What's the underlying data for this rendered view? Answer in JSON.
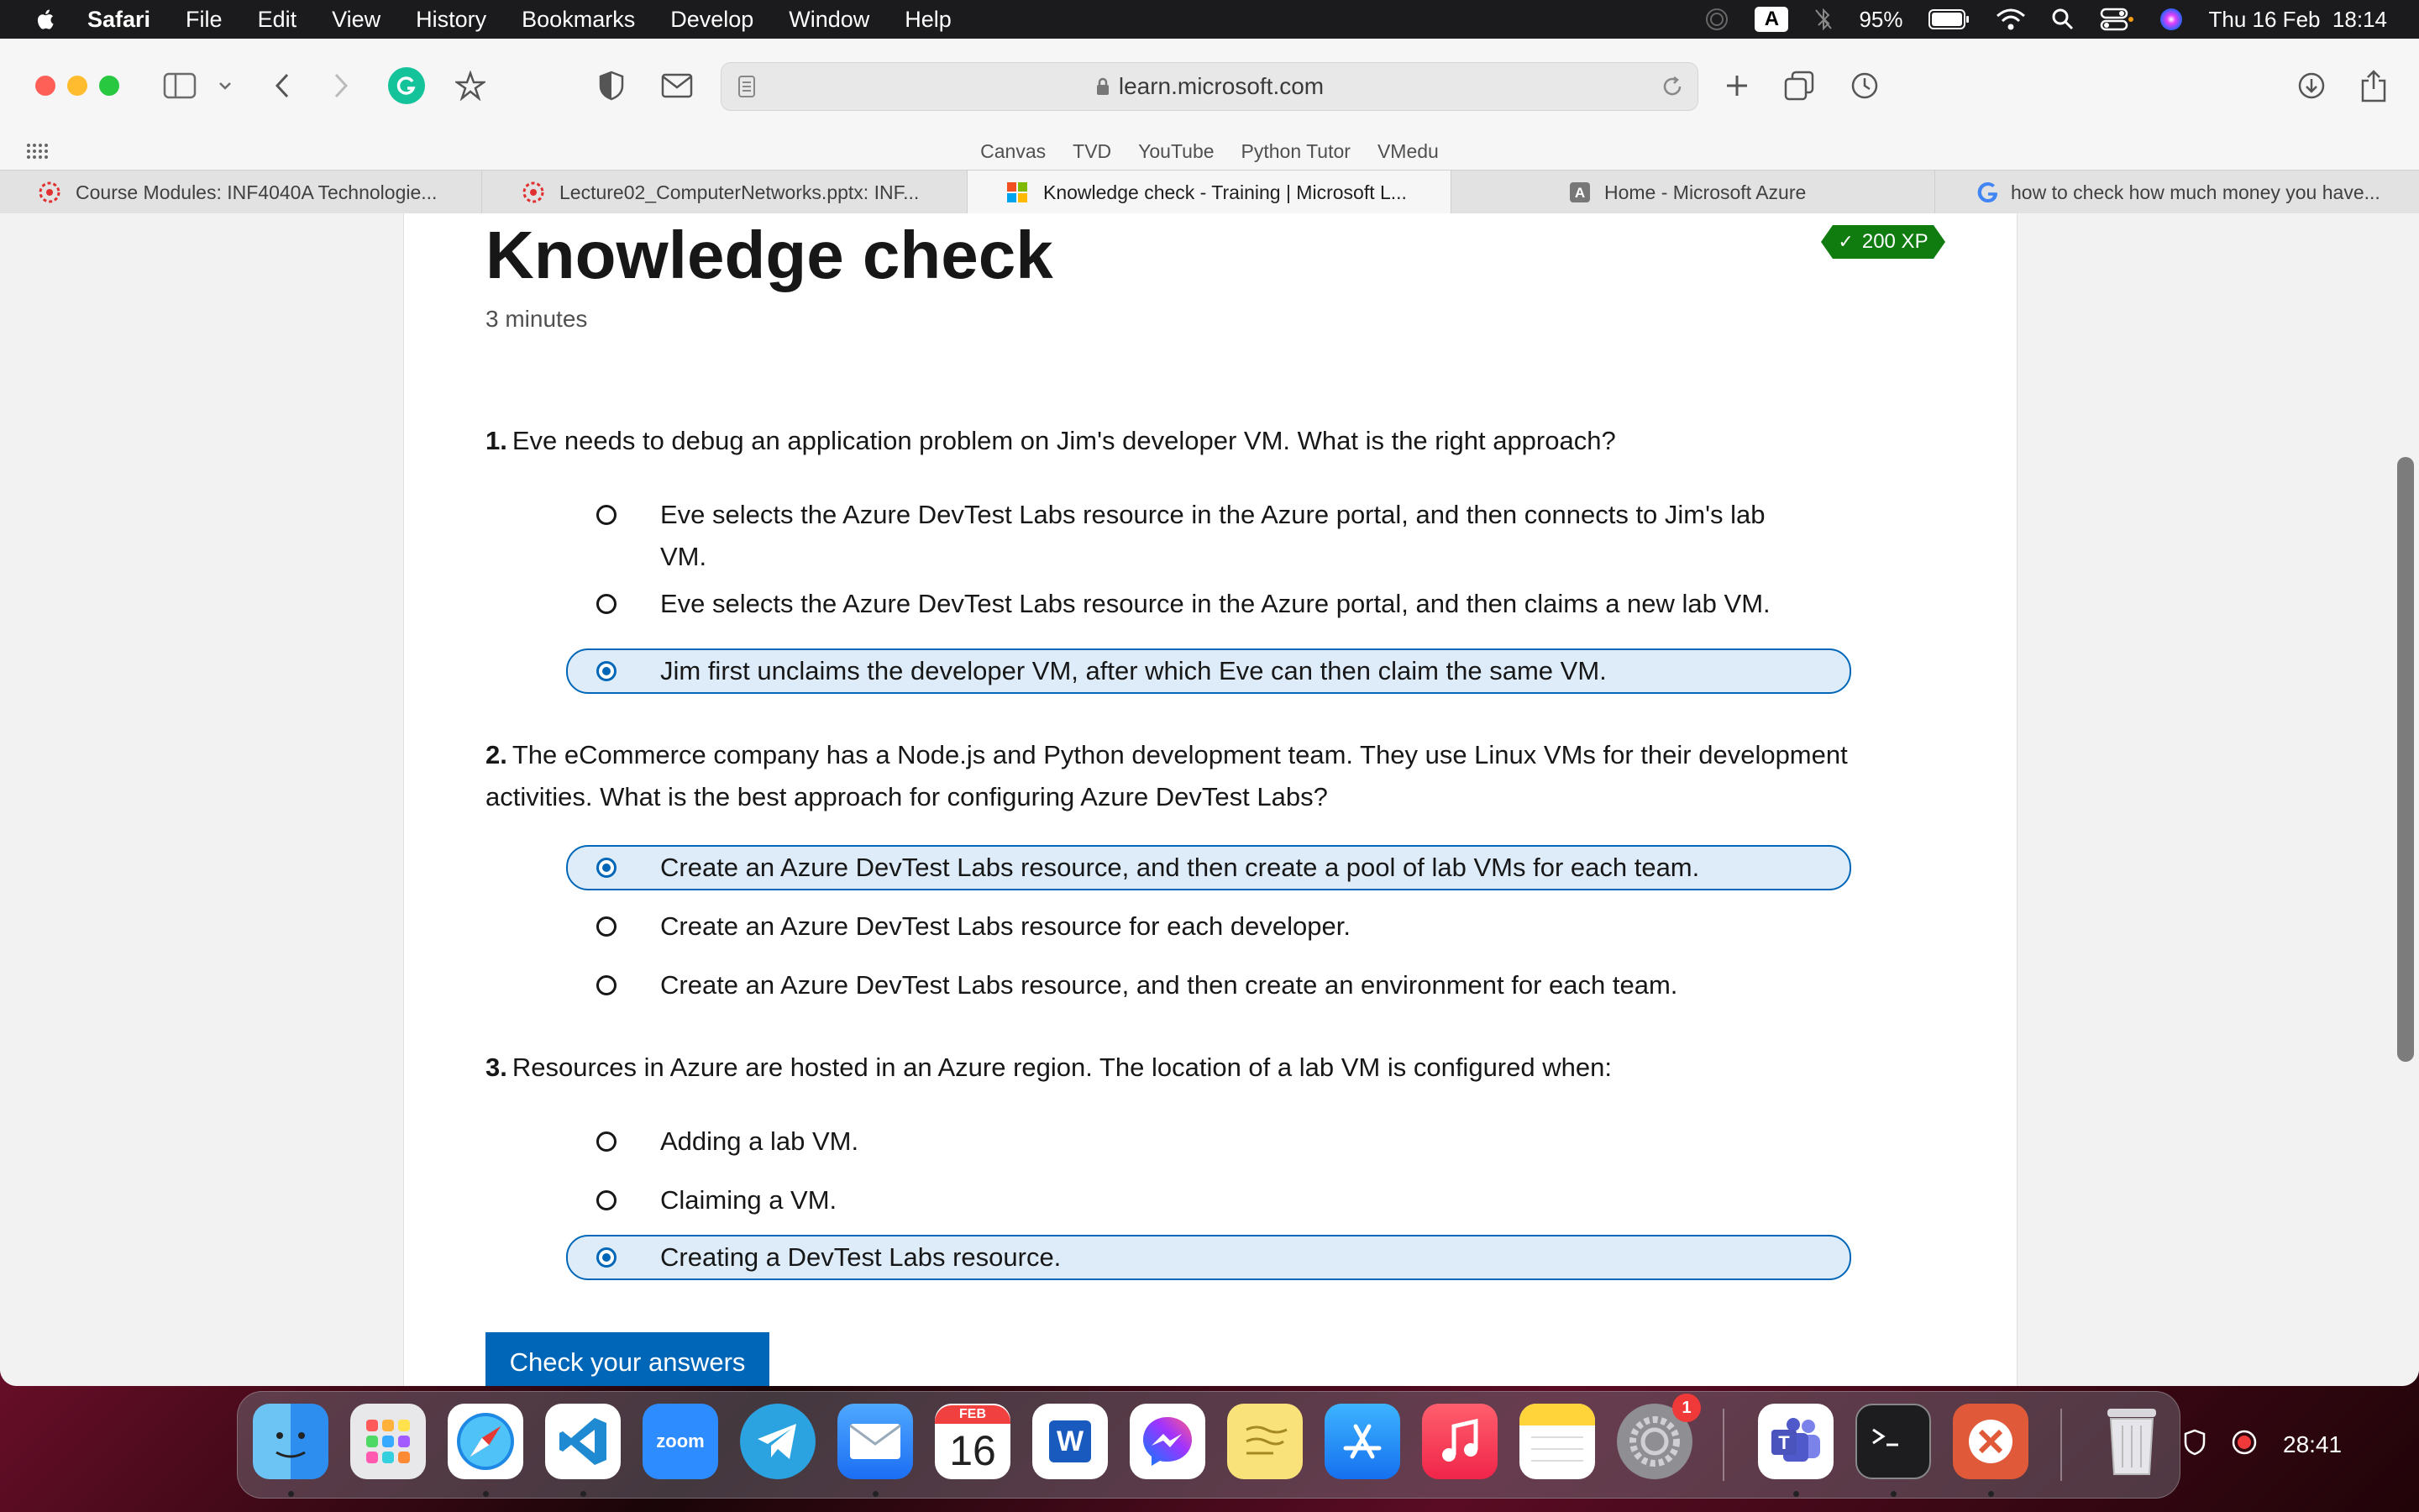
{
  "menubar": {
    "app": "Safari",
    "items": [
      "File",
      "Edit",
      "View",
      "History",
      "Bookmarks",
      "Develop",
      "Window",
      "Help"
    ],
    "keyboard_letter": "A",
    "battery": "95%",
    "datetime": "Thu 16 Feb  18:14"
  },
  "browser": {
    "address": "learn.microsoft.com",
    "bookmarks": [
      "Canvas",
      "TVD",
      "YouTube",
      "Python Tutor",
      "VMedu"
    ],
    "tabs": [
      {
        "title": "Course Modules: INF4040A Technologie..."
      },
      {
        "title": "Lecture02_ComputerNetworks.pptx: INF..."
      },
      {
        "title": "Knowledge check - Training | Microsoft L..."
      },
      {
        "title": "Home - Microsoft Azure"
      },
      {
        "title": "how to check how much money you have..."
      }
    ],
    "active_tab_index": 2
  },
  "page": {
    "title": "Knowledge check",
    "duration": "3 minutes",
    "xp": "200 XP",
    "questions": [
      {
        "number": "1.",
        "text": "Eve needs to debug an application problem on Jim's developer VM. What is the right approach?",
        "options": [
          "Eve selects the Azure DevTest Labs resource in the Azure portal, and then connects to Jim's lab VM.",
          "Eve selects the Azure DevTest Labs resource in the Azure portal, and then claims a new lab VM.",
          "Jim first unclaims the developer VM, after which Eve can then claim the same VM."
        ],
        "selected": 2
      },
      {
        "number": "2.",
        "text": "The eCommerce company has a Node.js and Python development team. They use Linux VMs for their development activities. What is the best approach for configuring Azure DevTest Labs?",
        "options": [
          "Create an Azure DevTest Labs resource, and then create a pool of lab VMs for each team.",
          "Create an Azure DevTest Labs resource for each developer.",
          "Create an Azure DevTest Labs resource, and then create an environment for each team."
        ],
        "selected": 0
      },
      {
        "number": "3.",
        "text": "Resources in Azure are hosted in an Azure region. The location of a lab VM is configured when:",
        "options": [
          "Adding a lab VM.",
          "Claiming a VM.",
          "Creating a DevTest Labs resource."
        ],
        "selected": 2
      }
    ],
    "submit_label": "Check your answers"
  },
  "dock": {
    "calendar_month": "FEB",
    "calendar_day": "16",
    "zoom_label": "zoom",
    "word_letter": "W",
    "settings_badge": "1",
    "timer": "28:41",
    "apps": [
      "Finder",
      "Launchpad",
      "Safari",
      "Visual Studio Code",
      "Zoom",
      "Telegram",
      "Mail",
      "Calendar",
      "Word",
      "Messenger",
      "Stickies",
      "App Store",
      "Music",
      "Notes",
      "System Settings",
      "Teams",
      "Terminal",
      "Remote Desktop",
      "Trash"
    ]
  },
  "colors": {
    "accent": "#0067b8",
    "selected_bg": "#deecf9",
    "xp_badge": "#107c10"
  }
}
